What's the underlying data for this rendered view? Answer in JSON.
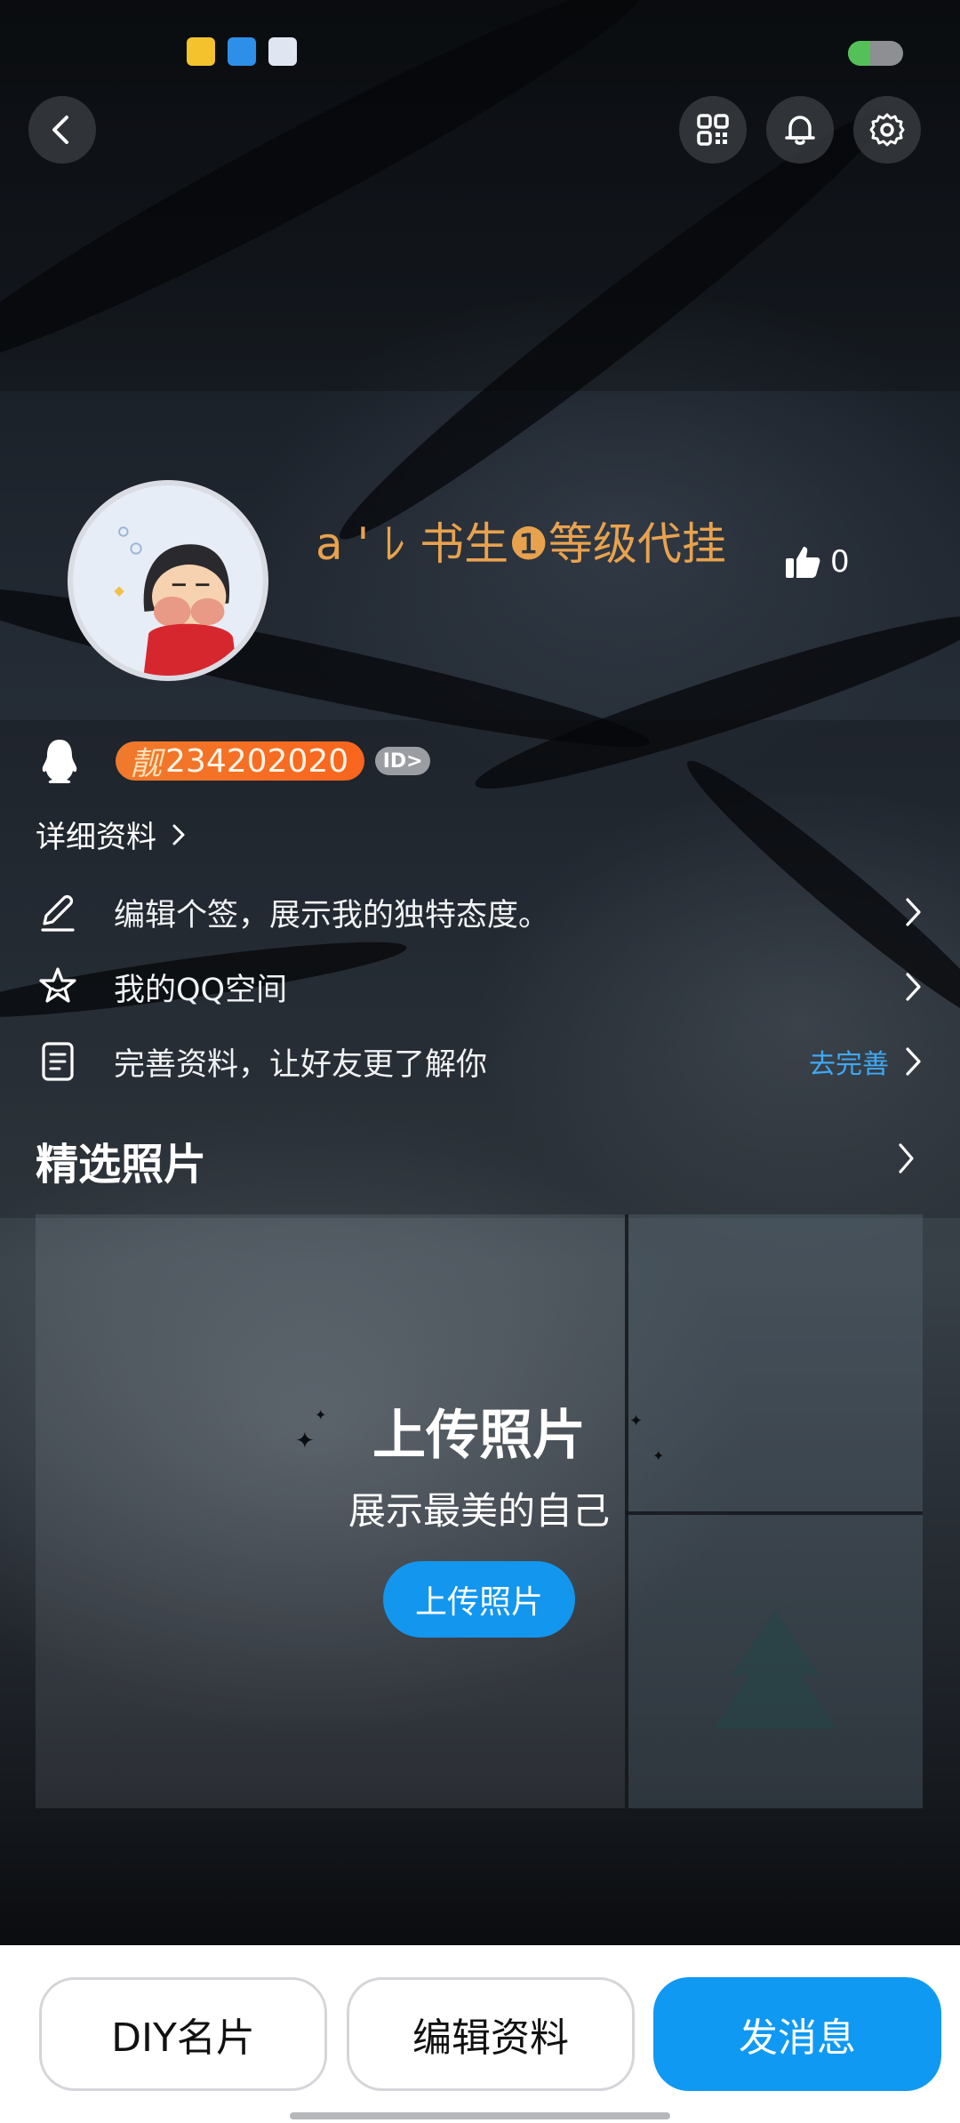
{
  "profile": {
    "nickname": "a ' ﾚ 书生❶等级代挂",
    "likes": "0",
    "uid_prefix": "靓",
    "uid": "234202020",
    "id_badge": "ID>",
    "detail_link": "详细资料"
  },
  "rows": [
    {
      "label": "编辑个签，展示我的独特态度。",
      "icon": "pencil-icon",
      "hint": ""
    },
    {
      "label": "我的QQ空间",
      "icon": "star-icon",
      "hint": ""
    },
    {
      "label": "完善资料，让好友更了解你",
      "icon": "document-icon",
      "hint": "去完善"
    }
  ],
  "photos": {
    "section_title": "精选照片",
    "upload_title": "上传照片",
    "upload_subtitle": "展示最美的自己",
    "upload_button": "上传照片"
  },
  "bottom_bar": {
    "diy_label": "DIY名片",
    "edit_label": "编辑资料",
    "message_label": "发消息"
  },
  "colors": {
    "accent_blue": "#0f99f2",
    "nickname_gold": "#e8a24e",
    "uid_orange": "#f9651d",
    "hint_blue": "#3fa9f5"
  }
}
